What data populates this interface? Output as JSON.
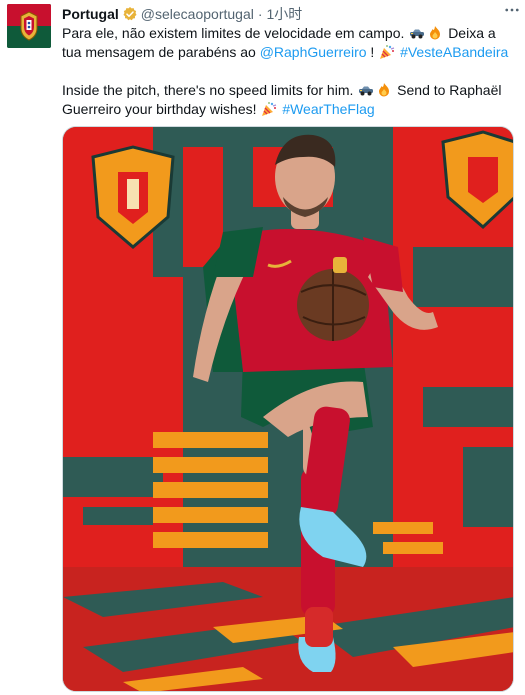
{
  "tweet": {
    "display_name": "Portugal",
    "handle": "@selecaoportugal",
    "separator": "·",
    "time": "1小时",
    "verified": true,
    "text_pt": {
      "part1": "Para ele, não existem limites de velocidade em campo.",
      "part2": "Deixa a tua mensagem de parabéns ao",
      "mention": "@RaphGuerreiro",
      "part3": "!",
      "hashtag": "#VesteABandeira"
    },
    "text_en": {
      "part1": "Inside the pitch, there's no speed limits for him.",
      "part2": "Send to Raphaël Guerreiro your birthday wishes!",
      "hashtag": "#WearTheFlag"
    }
  },
  "colors": {
    "link": "#1d9bf0",
    "secondary_text": "#536471",
    "verified_badge": "#e8b33a",
    "kit_red": "#c8102e",
    "kit_green": "#0f5a3a",
    "background_red": "#e0201e",
    "background_teal": "#2f5b55",
    "background_orange": "#f29a1c"
  },
  "icons": {
    "verified": "verified-badge-icon",
    "more": "more-options-icon",
    "emoji_car": "racing-car-emoji",
    "emoji_fire": "fire-emoji",
    "emoji_party": "party-popper-emoji"
  }
}
